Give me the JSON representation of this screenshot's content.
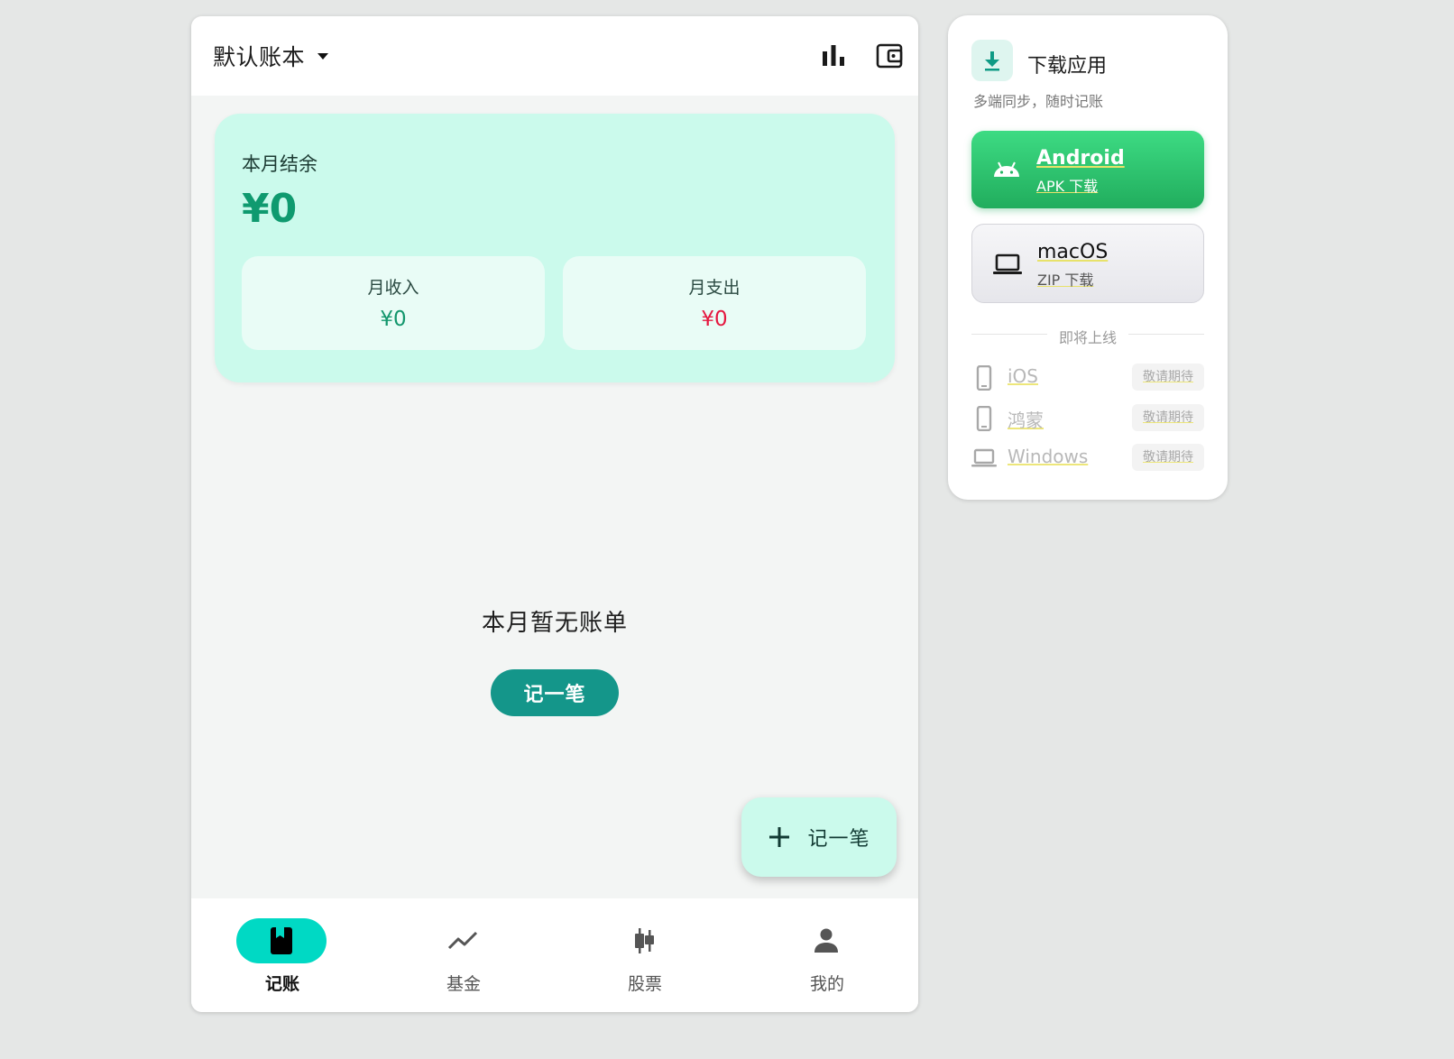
{
  "header": {
    "ledger_name": "默认账本"
  },
  "summary": {
    "title": "本月结余",
    "balance": "¥0",
    "income_label": "月收入",
    "income_value": "¥0",
    "expense_label": "月支出",
    "expense_value": "¥0"
  },
  "empty_state": {
    "message": "本月暂无账单",
    "button_label": "记一笔"
  },
  "fab": {
    "label": "记一笔"
  },
  "bottom_nav": {
    "items": [
      {
        "label": "记账",
        "icon": "book-icon",
        "active": true
      },
      {
        "label": "基金",
        "icon": "trend-icon",
        "active": false
      },
      {
        "label": "股票",
        "icon": "candlestick-icon",
        "active": false
      },
      {
        "label": "我的",
        "icon": "person-icon",
        "active": false
      }
    ]
  },
  "download": {
    "title": "下载应用",
    "subtitle": "多端同步，随时记账",
    "android": {
      "name": "Android",
      "sub": "APK 下载"
    },
    "macos": {
      "name": "macOS",
      "sub": "ZIP 下载"
    },
    "coming_soon_label": "即将上线",
    "coming_soon": [
      {
        "name": "iOS",
        "badge": "敬请期待"
      },
      {
        "name": "鸿蒙",
        "badge": "敬请期待"
      },
      {
        "name": "Windows",
        "badge": "敬请期待"
      }
    ]
  },
  "colors": {
    "accent_mint": "#cbfaec",
    "primary_teal": "#14968a",
    "active_nav": "#00d9c4",
    "income_green": "#12966c",
    "expense_red": "#e5173f",
    "android_green": "#2ec36f"
  }
}
